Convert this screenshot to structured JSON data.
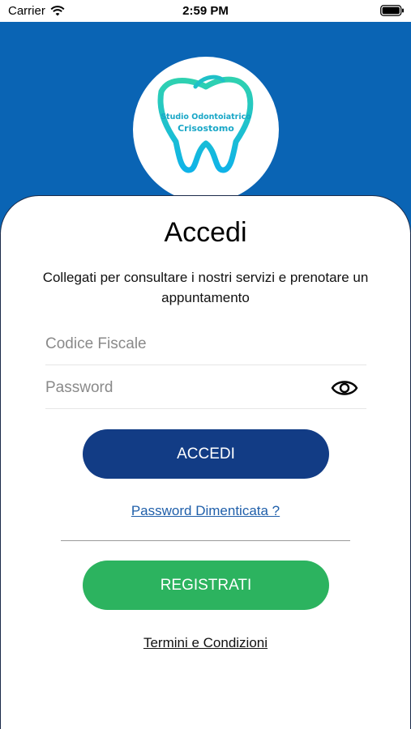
{
  "status_bar": {
    "carrier": "Carrier",
    "time": "2:59 PM"
  },
  "logo": {
    "line1": "Studio Odontoiatrico",
    "line2": "Crisostomo"
  },
  "login": {
    "title": "Accedi",
    "subtitle": "Collegati per consultare i nostri servizi e prenotare un appuntamento",
    "fiscal_code_placeholder": "Codice Fiscale",
    "password_placeholder": "Password",
    "login_button": "ACCEDI",
    "forgot_password": "Password Dimenticata ?",
    "register_button": "REGISTRATI",
    "terms": "Termini e Condizioni"
  },
  "colors": {
    "header_blue": "#0a64b4",
    "login_button": "#123c85",
    "register_button": "#2cb35f",
    "link_blue": "#1f5faa"
  }
}
